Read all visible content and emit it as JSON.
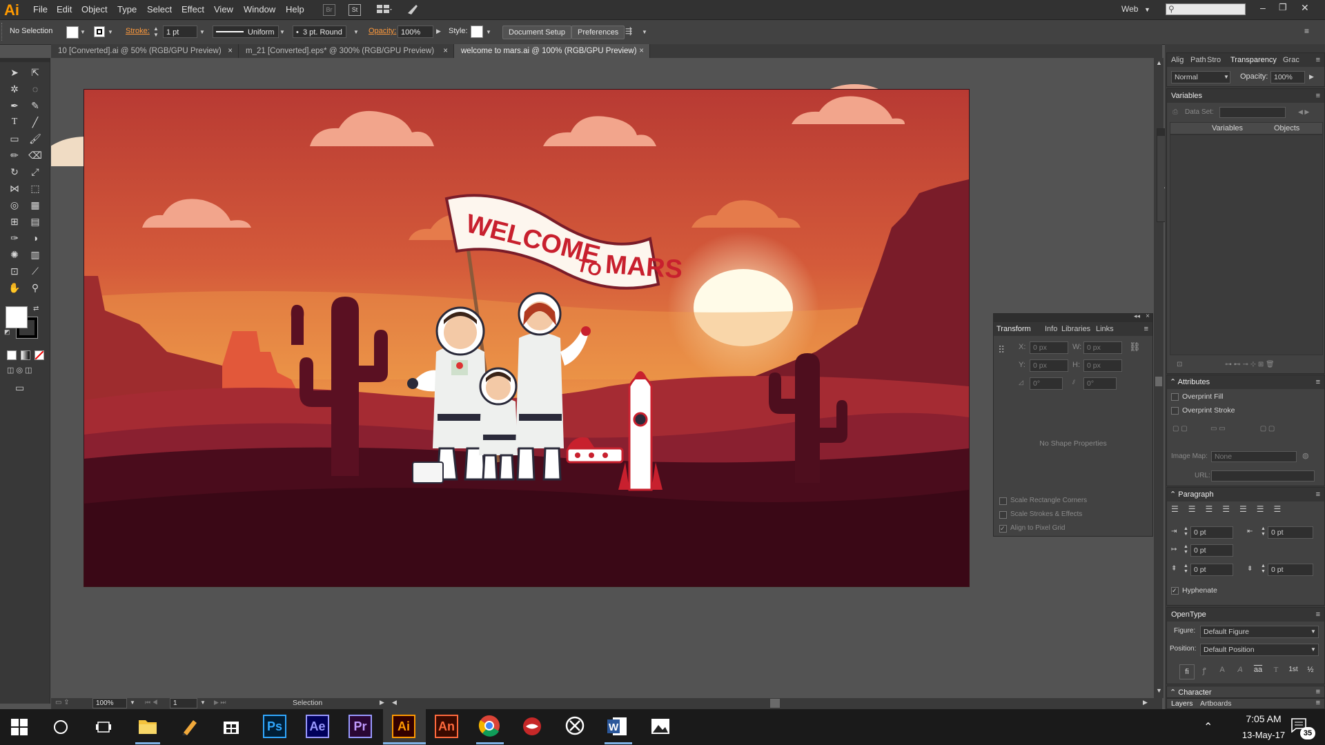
{
  "app": {
    "logo": "Ai"
  },
  "menu": [
    "File",
    "Edit",
    "Object",
    "Type",
    "Select",
    "Effect",
    "View",
    "Window",
    "Help"
  ],
  "menubar_right": {
    "workspace": "Web",
    "search_placeholder": ""
  },
  "menubar_misc": {
    "br": "Br",
    "st": "St"
  },
  "control": {
    "selection": "No Selection",
    "stroke_label": "Stroke:",
    "stroke_weight": "1 pt",
    "stroke_profile": "Uniform",
    "brush": "3 pt. Round",
    "opacity_label": "Opacity:",
    "opacity_value": "100%",
    "style_label": "Style:",
    "document_setup": "Document Setup",
    "preferences": "Preferences"
  },
  "tabs": [
    {
      "label": "10 [Converted].ai @ 50% (RGB/GPU Preview)"
    },
    {
      "label": "m_21 [Converted].eps* @ 300% (RGB/GPU Preview)"
    },
    {
      "label": "welcome to mars.ai @ 100% (RGB/GPU Preview)"
    }
  ],
  "artwork": {
    "banner_big": "WELCOME",
    "banner_small": "TO",
    "banner_end": "MARS"
  },
  "transform_panel": {
    "tabs": [
      "Transform",
      "Info",
      "Libraries",
      "Links"
    ],
    "x_label": "X:",
    "x_value": "0 px",
    "y_label": "Y:",
    "y_value": "0 px",
    "w_label": "W:",
    "w_value": "0 px",
    "h_label": "H:",
    "h_value": "0 px",
    "rot_value": "0°",
    "shear_value": "0°",
    "no_shape": "No Shape Properties",
    "scale_rect": "Scale Rectangle Corners",
    "scale_strokes": "Scale Strokes & Effects",
    "align_pixel": "Align to Pixel Grid"
  },
  "transparency_panel": {
    "tabs": [
      "Alig",
      "Path",
      "Stro",
      "Transparency",
      "Grac"
    ],
    "blend_mode": "Normal",
    "opacity_label": "Opacity:",
    "opacity_value": "100%"
  },
  "variables_panel": {
    "title": "Variables",
    "dataset_label": "Data Set:",
    "col_variables": "Variables",
    "col_objects": "Objects"
  },
  "attributes_panel": {
    "title": "Attributes",
    "overprint_fill": "Overprint Fill",
    "overprint_stroke": "Overprint Stroke",
    "image_map_label": "Image Map:",
    "image_map_value": "None",
    "url_label": "URL:"
  },
  "paragraph_panel": {
    "title": "Paragraph",
    "left_indent": "0 pt",
    "right_indent": "0 pt",
    "first_line": "0 pt",
    "space_before": "0 pt",
    "space_after": "0 pt",
    "hyphenate": "Hyphenate"
  },
  "opentype_panel": {
    "title": "OpenType",
    "figure_label": "Figure:",
    "figure_value": "Default Figure",
    "position_label": "Position:",
    "position_value": "Default Position",
    "glyphs": [
      "fi",
      "ꝭ",
      "A",
      "A",
      "aa",
      "T",
      "1st",
      "½"
    ]
  },
  "character_panel": {
    "title": "Character"
  },
  "layers_panel": {
    "tabs": [
      "Layers",
      "Artboards"
    ]
  },
  "statusbar": {
    "zoom": "100%",
    "artboard": "1",
    "tool": "Selection"
  },
  "taskbar": {
    "time": "7:05 AM",
    "date": "13-May-17",
    "notifications": "35",
    "apps": [
      {
        "name": "Ps",
        "color": "#31a8ff",
        "bg": "#001e36"
      },
      {
        "name": "Ae",
        "color": "#9999ff",
        "bg": "#00005b"
      },
      {
        "name": "Pr",
        "color": "#9999ff",
        "bg": "#2a0634"
      },
      {
        "name": "Ai",
        "color": "#ff9a00",
        "bg": "#330000"
      },
      {
        "name": "An",
        "color": "#ff6a3d",
        "bg": "#3a0a00"
      }
    ]
  }
}
